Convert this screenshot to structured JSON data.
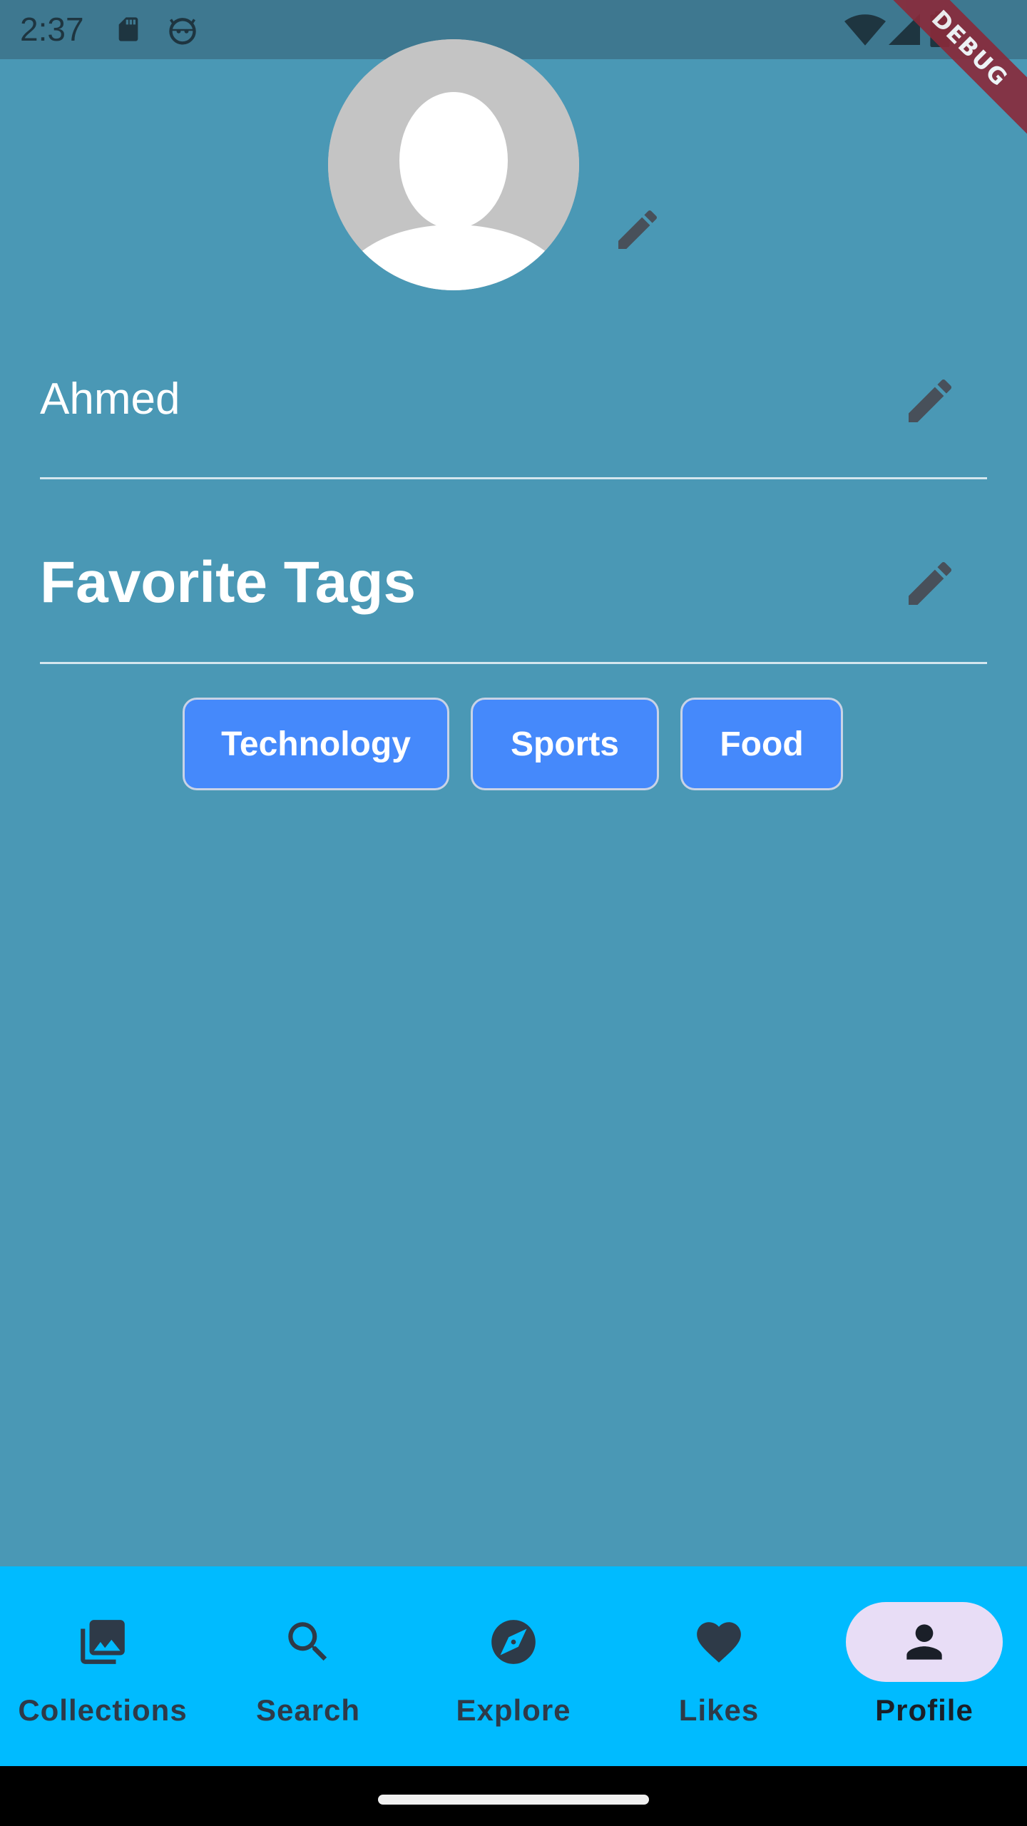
{
  "status_bar": {
    "time": "2:37",
    "icons": [
      "sd-card-icon",
      "debug-bot-icon",
      "wifi-icon",
      "signal-icon",
      "battery-icon"
    ]
  },
  "debug_banner": {
    "label": "DEBUG"
  },
  "profile": {
    "avatar": {
      "icon": "person-placeholder-icon"
    },
    "name": "Ahmed",
    "favorite_tags_heading": "Favorite Tags",
    "tags": [
      "Technology",
      "Sports",
      "Food"
    ]
  },
  "bottom_nav": {
    "items": [
      {
        "label": "Collections",
        "icon": "photo-library-icon",
        "active": false
      },
      {
        "label": "Search",
        "icon": "search-icon",
        "active": false
      },
      {
        "label": "Explore",
        "icon": "compass-icon",
        "active": false
      },
      {
        "label": "Likes",
        "icon": "heart-icon",
        "active": false
      },
      {
        "label": "Profile",
        "icon": "person-icon",
        "active": true
      }
    ]
  },
  "colors": {
    "background": "#4a98b5",
    "status_bar": "#3e7890",
    "chip_fill": "#4589fb",
    "nav_bar": "#00bbff",
    "nav_active_pill": "#e8ddf6",
    "edit_icon": "#48505a"
  }
}
